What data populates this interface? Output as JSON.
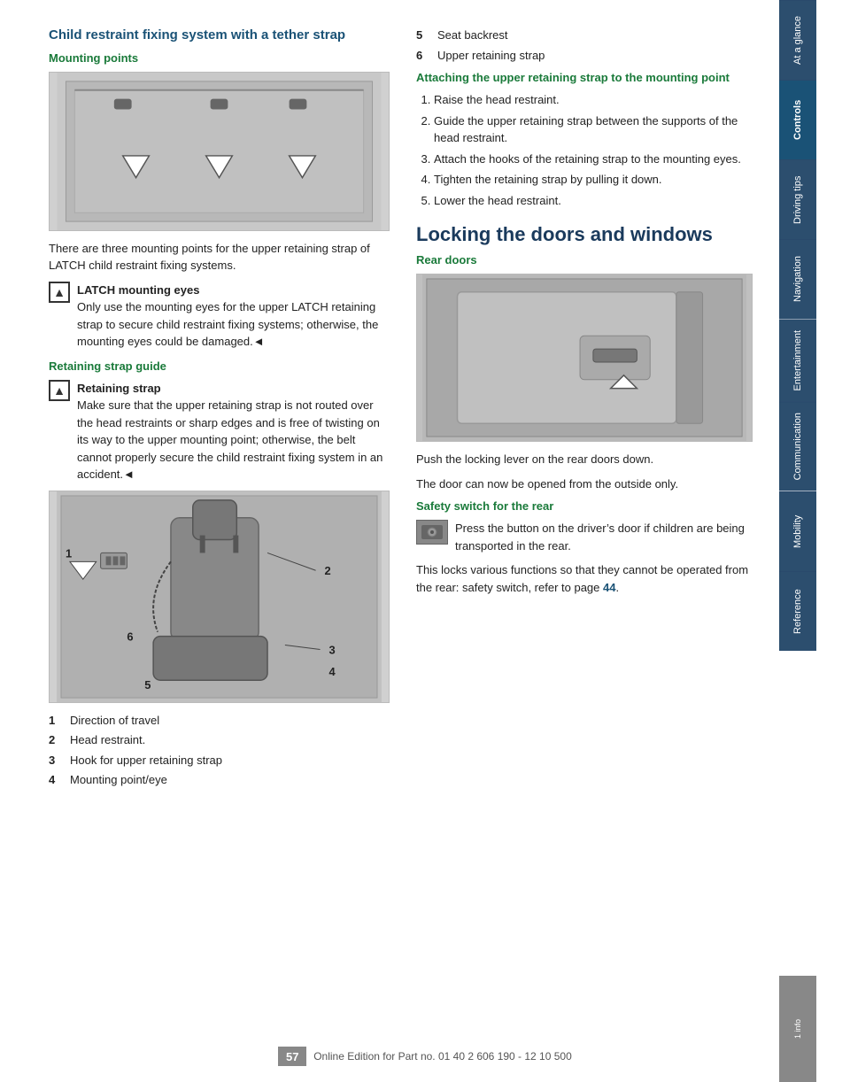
{
  "page": {
    "number": "57",
    "footer_text": "Online Edition for Part no. 01 40 2 606 190 - 12 10 500"
  },
  "sidebar": {
    "tabs": [
      {
        "label": "At a glance",
        "active": false
      },
      {
        "label": "Controls",
        "active": true
      },
      {
        "label": "Driving tips",
        "active": false
      },
      {
        "label": "Navigation",
        "active": false
      },
      {
        "label": "Entertainment",
        "active": false
      },
      {
        "label": "Communication",
        "active": false
      },
      {
        "label": "Mobility",
        "active": false
      },
      {
        "label": "Reference",
        "active": false
      }
    ],
    "info_label": "1 info"
  },
  "left_column": {
    "section_title": "Child restraint fixing system with a tether strap",
    "subsection_mounting": "Mounting points",
    "mounting_description": "There are three mounting points for the upper retaining strap of LATCH child restraint fixing systems.",
    "warning1": {
      "title": "LATCH mounting eyes",
      "text": "Only use the mounting eyes for the upper LATCH retaining strap to secure child restraint fixing systems; otherwise, the mounting eyes could be damaged.◄"
    },
    "retaining_guide_title": "Retaining strap guide",
    "warning2": {
      "title": "Retaining strap",
      "text": "Make sure that the upper retaining strap is not routed over the head restraints or sharp edges and is free of twisting on its way to the upper mounting point; otherwise, the belt cannot properly secure the child restraint fixing system in an accident.◄"
    },
    "numbered_items": [
      {
        "num": "1",
        "label": "Direction of travel"
      },
      {
        "num": "2",
        "label": "Head restraint."
      },
      {
        "num": "3",
        "label": "Hook for upper retaining strap"
      },
      {
        "num": "4",
        "label": "Mounting point/eye"
      },
      {
        "num": "5",
        "label": "Seat backrest"
      },
      {
        "num": "6",
        "label": "Upper retaining strap"
      }
    ]
  },
  "right_column": {
    "items_5_6": [
      {
        "num": "5",
        "label": "Seat backrest"
      },
      {
        "num": "6",
        "label": "Upper retaining strap"
      }
    ],
    "attaching_title": "Attaching the upper retaining strap to the mounting point",
    "attaching_steps": [
      "Raise the head restraint.",
      "Guide the upper retaining strap between the supports of the head restraint.",
      "Attach the hooks of the retaining strap to the mounting eyes.",
      "Tighten the retaining strap by pulling it down.",
      "Lower the head restraint."
    ],
    "locking_title": "Locking the doors and windows",
    "rear_doors_title": "Rear doors",
    "rear_doors_text1": "Push the locking lever on the rear doors down.",
    "rear_doors_text2": "The door can now be opened from the outside only.",
    "safety_switch_title": "Safety switch for the rear",
    "safety_switch_text": "Press the button on the driver’s door if children are being transported in the rear.",
    "safety_switch_text2": "This locks various functions so that they cannot be operated from the rear: safety switch, refer to page",
    "safety_page_link": "44",
    "safety_text_end": "."
  }
}
